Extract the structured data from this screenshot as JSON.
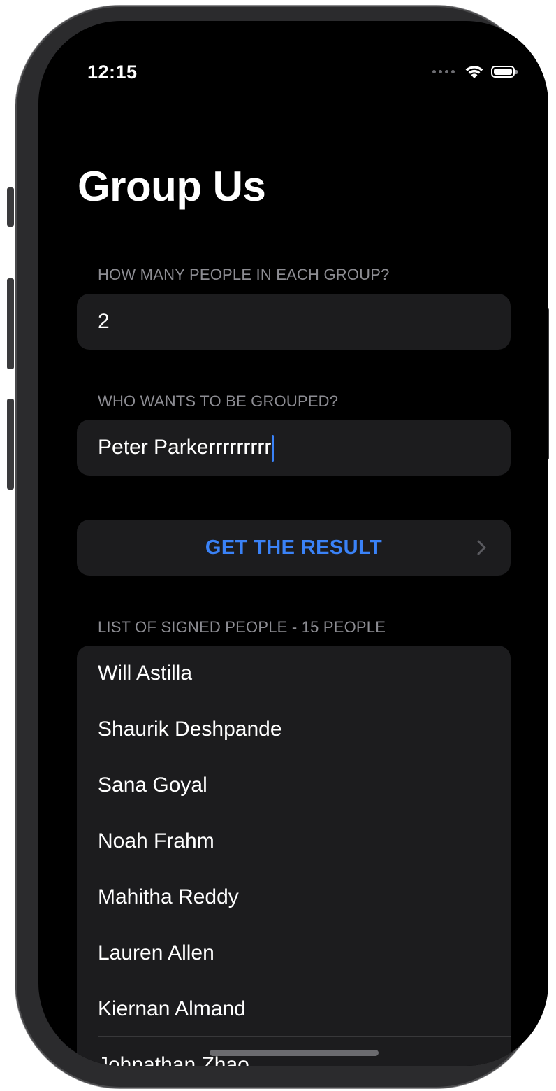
{
  "status_bar": {
    "time": "12:15",
    "signal_icon": "cellular-dots-icon",
    "wifi_icon": "wifi-icon",
    "battery_icon": "battery-icon",
    "battery_level": 1.0
  },
  "title": "Group Us",
  "group_size_section": {
    "header": "HOW MANY PEOPLE IN EACH GROUP?",
    "value": "2"
  },
  "name_section": {
    "header": "WHO WANTS TO BE GROUPED?",
    "value": "Peter Parkerrrrrrrrr"
  },
  "result_button": {
    "label": "GET THE RESULT",
    "icon": "chevron-right-icon"
  },
  "people_list": {
    "header": "LIST OF SIGNED PEOPLE - 15 PEOPLE",
    "items": [
      "Will Astilla",
      "Shaurik Deshpande",
      "Sana Goyal",
      "Noah Frahm",
      "Mahitha Reddy",
      "Lauren Allen",
      "Kiernan Almand",
      "Johnathan Zhao"
    ]
  },
  "colors": {
    "accent": "#3a82f7",
    "background": "#000000",
    "card": "#1c1c1e",
    "secondary_text": "#8d8d93"
  }
}
